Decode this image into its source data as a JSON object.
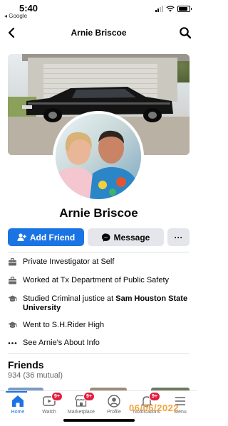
{
  "status_bar": {
    "time": "5:40",
    "back_app": "◂ Google",
    "battery_level": 0.85
  },
  "header": {
    "title": "Arnie Briscoe"
  },
  "profile": {
    "name": "Arnie Briscoe"
  },
  "actions": {
    "add_friend": "Add Friend",
    "message": "Message",
    "more": "···"
  },
  "details": [
    {
      "icon": "briefcase-icon",
      "text": "Private Investigator at Self",
      "bold": ""
    },
    {
      "icon": "briefcase-icon",
      "text": "Worked at Tx Department of Public Safety",
      "bold": ""
    },
    {
      "icon": "graduation-cap-icon",
      "text": "Studied Criminal justice at ",
      "bold": "Sam Houston State University"
    },
    {
      "icon": "graduation-cap-icon",
      "text": "Went to S.H.Rider High",
      "bold": ""
    },
    {
      "icon": "ellipsis-icon",
      "text": "See Arnie's About Info",
      "bold": ""
    }
  ],
  "friends": {
    "title": "Friends",
    "count": "934 (36 mutual)"
  },
  "nav": {
    "home": "Home",
    "watch": "Watch",
    "watch_badge": "9+",
    "marketplace": "Marketplace",
    "marketplace_badge": "9+",
    "profile": "Profile",
    "notifications": "Notifications",
    "notifications_badge": "9+",
    "menu": "Menu"
  },
  "date_stamp": "06/06/2022",
  "colors": {
    "accent": "#1b74e4",
    "badge": "#e41e3f",
    "button_gray": "#e4e6eb"
  }
}
